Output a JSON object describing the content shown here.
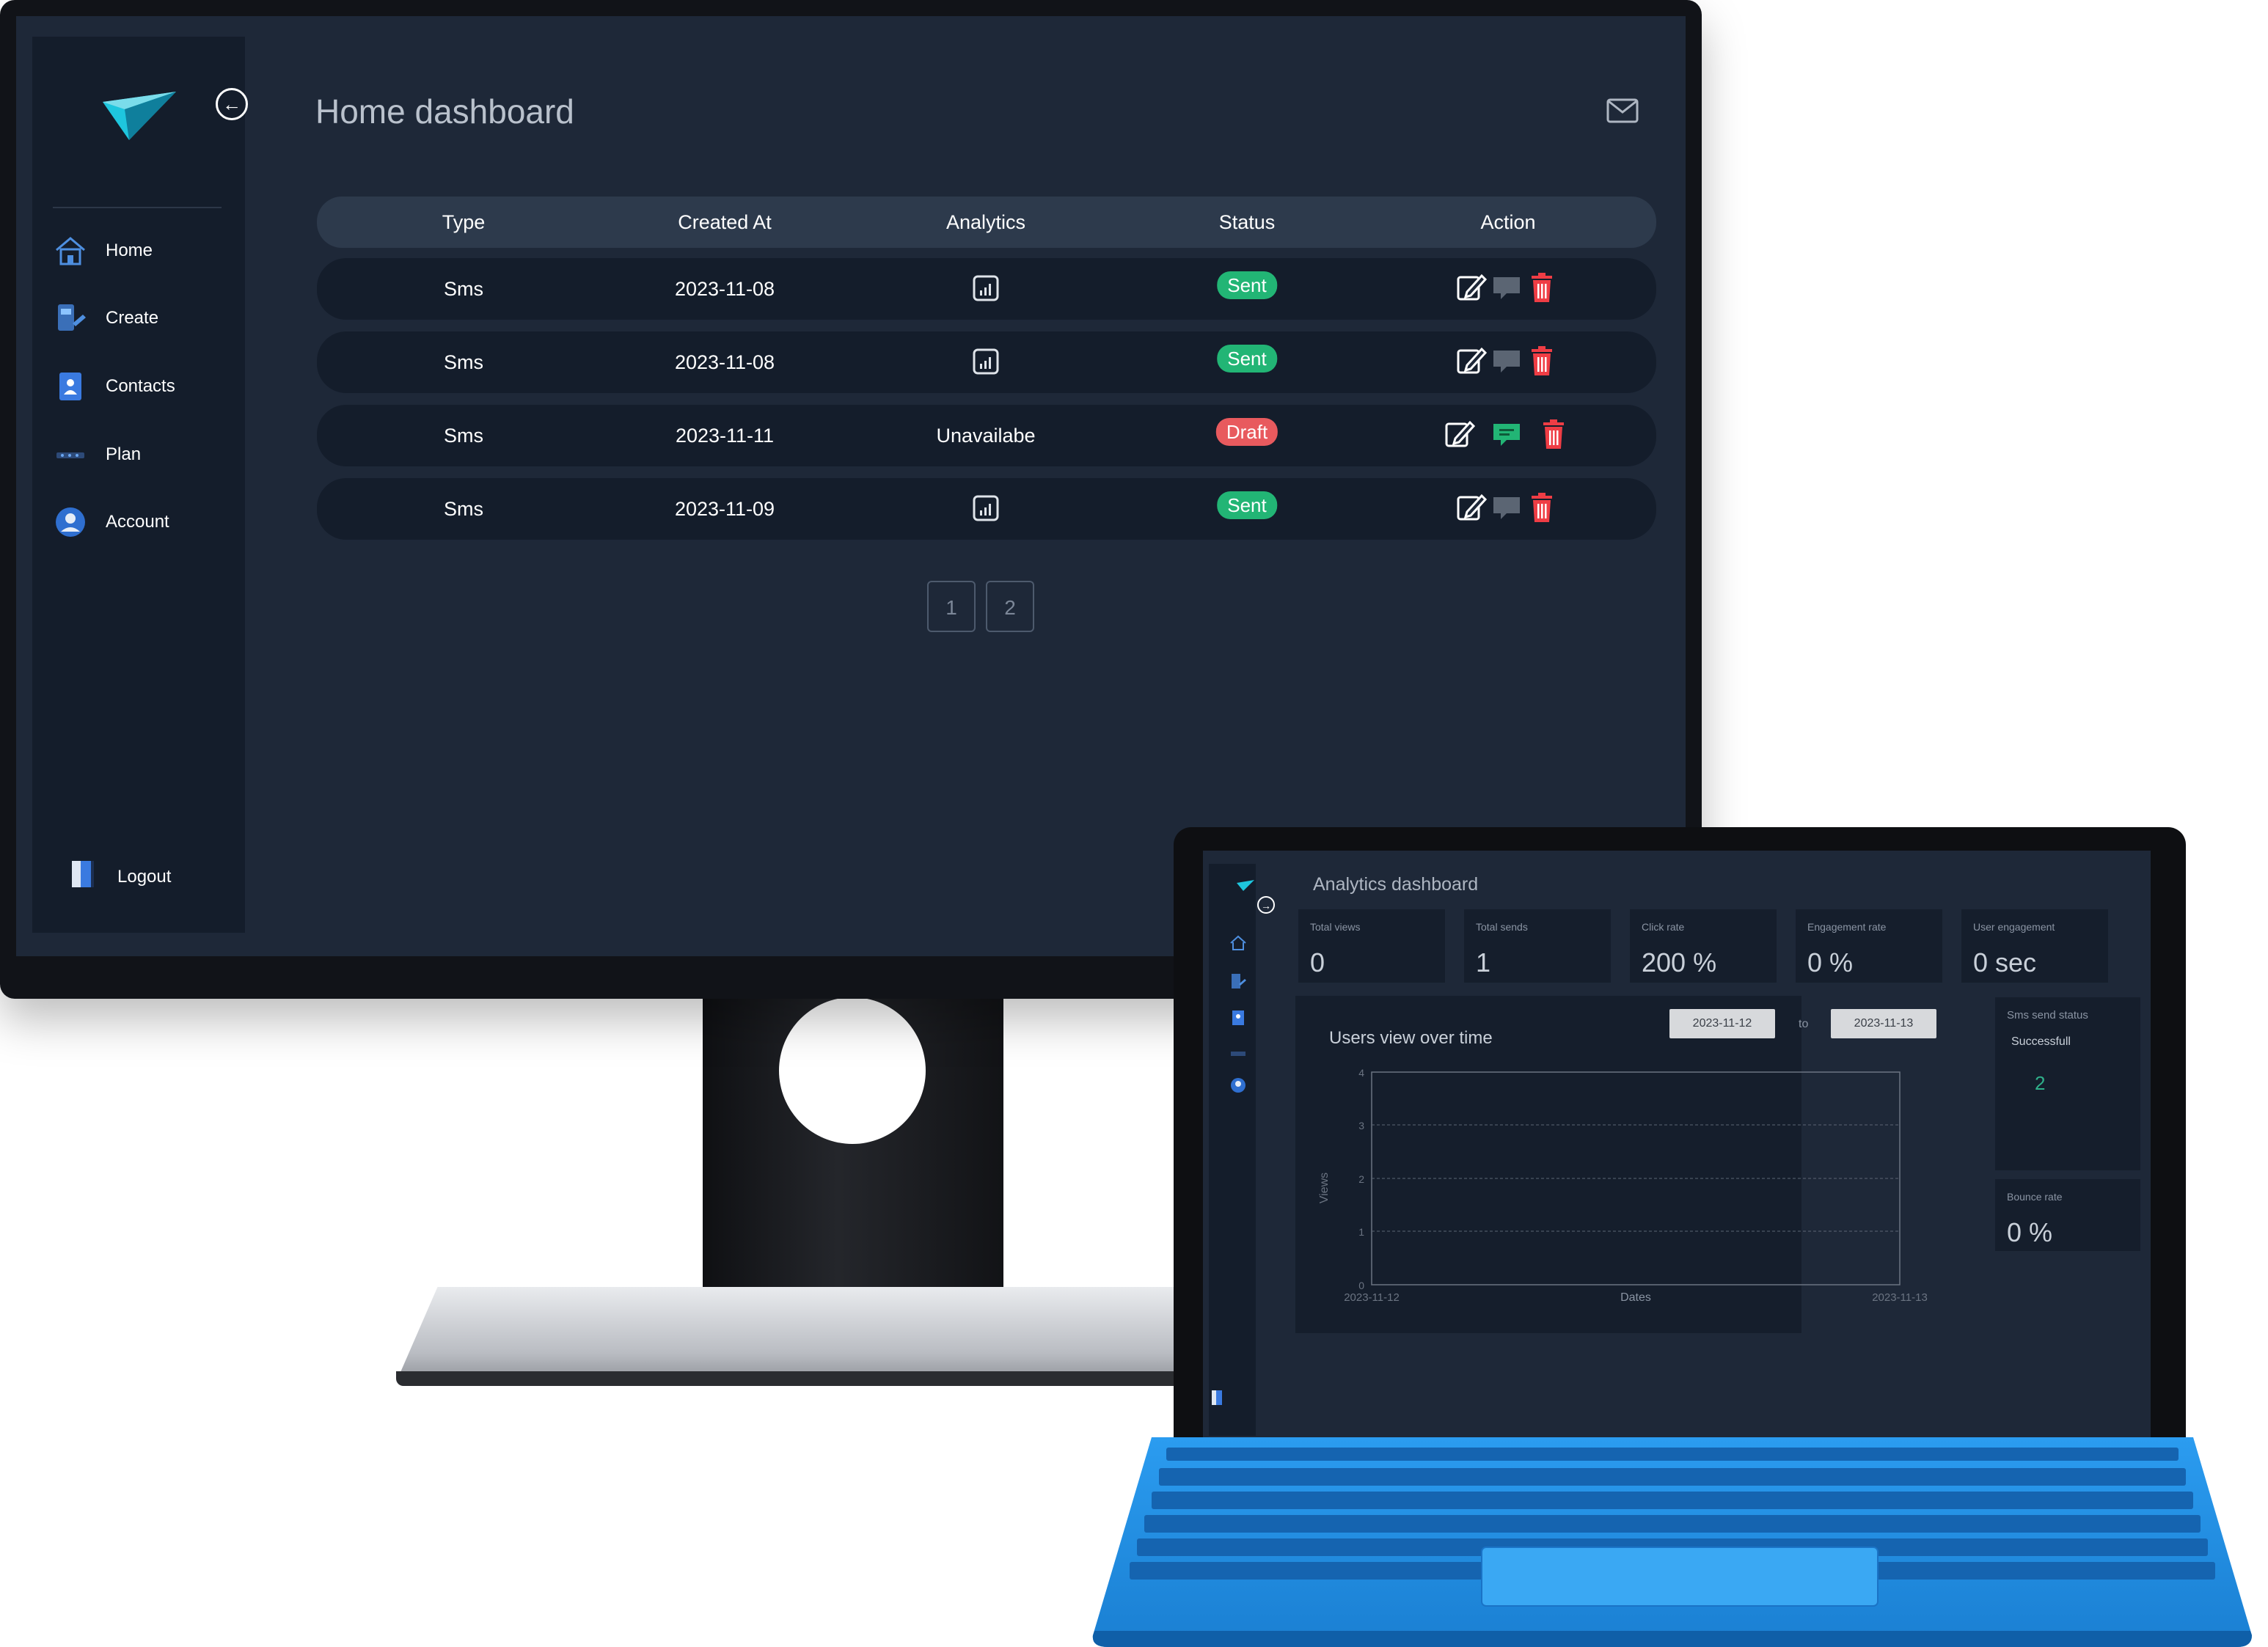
{
  "monitor": {
    "title": "Home dashboard",
    "nav": [
      {
        "label": "Home",
        "icon": "home-icon"
      },
      {
        "label": "Create",
        "icon": "create-icon"
      },
      {
        "label": "Contacts",
        "icon": "contacts-icon"
      },
      {
        "label": "Plan",
        "icon": "plan-icon"
      },
      {
        "label": "Account",
        "icon": "account-icon"
      }
    ],
    "logout_label": "Logout",
    "table": {
      "headers": [
        "Type",
        "Created At",
        "Analytics",
        "Status",
        "Action"
      ],
      "rows": [
        {
          "type": "Sms",
          "created_at": "2023-11-08",
          "analytics": "",
          "status": "Sent"
        },
        {
          "type": "Sms",
          "created_at": "2023-11-08",
          "analytics": "",
          "status": "Sent"
        },
        {
          "type": "Sms",
          "created_at": "2023-11-11",
          "analytics": "Unavailabe",
          "status": "Draft"
        },
        {
          "type": "Sms",
          "created_at": "2023-11-09",
          "analytics": "",
          "status": "Sent"
        }
      ]
    },
    "pagination": [
      "1",
      "2"
    ]
  },
  "laptop": {
    "title": "Analytics dashboard",
    "stats": [
      {
        "label": "Total views",
        "value": "0"
      },
      {
        "label": "Total sends",
        "value": "1"
      },
      {
        "label": "Click rate",
        "value": "200 %"
      },
      {
        "label": "Engagement rate",
        "value": "0 %"
      },
      {
        "label": "User engagement",
        "value": "0 sec"
      }
    ],
    "graph": {
      "title": "Users view over time",
      "date_from": "2023-11-12",
      "date_to_label": "to",
      "date_to": "2023-11-13",
      "ylabel": "Views",
      "xlabel": "Dates",
      "y_ticks": [
        "0",
        "1",
        "2",
        "3",
        "4"
      ],
      "x_ticks": [
        "2023-11-12",
        "2023-11-13"
      ]
    },
    "sms_status": {
      "label": "Sms send status",
      "sub_label": "Successfull",
      "value": "2"
    },
    "bounce": {
      "label": "Bounce rate",
      "value": "0 %"
    }
  },
  "colors": {
    "screen_bg": "#1e2838",
    "panel_bg": "#141d2b",
    "sent": "#22b575",
    "draft": "#e85a5e",
    "keyboard": "#1e8fe8"
  }
}
